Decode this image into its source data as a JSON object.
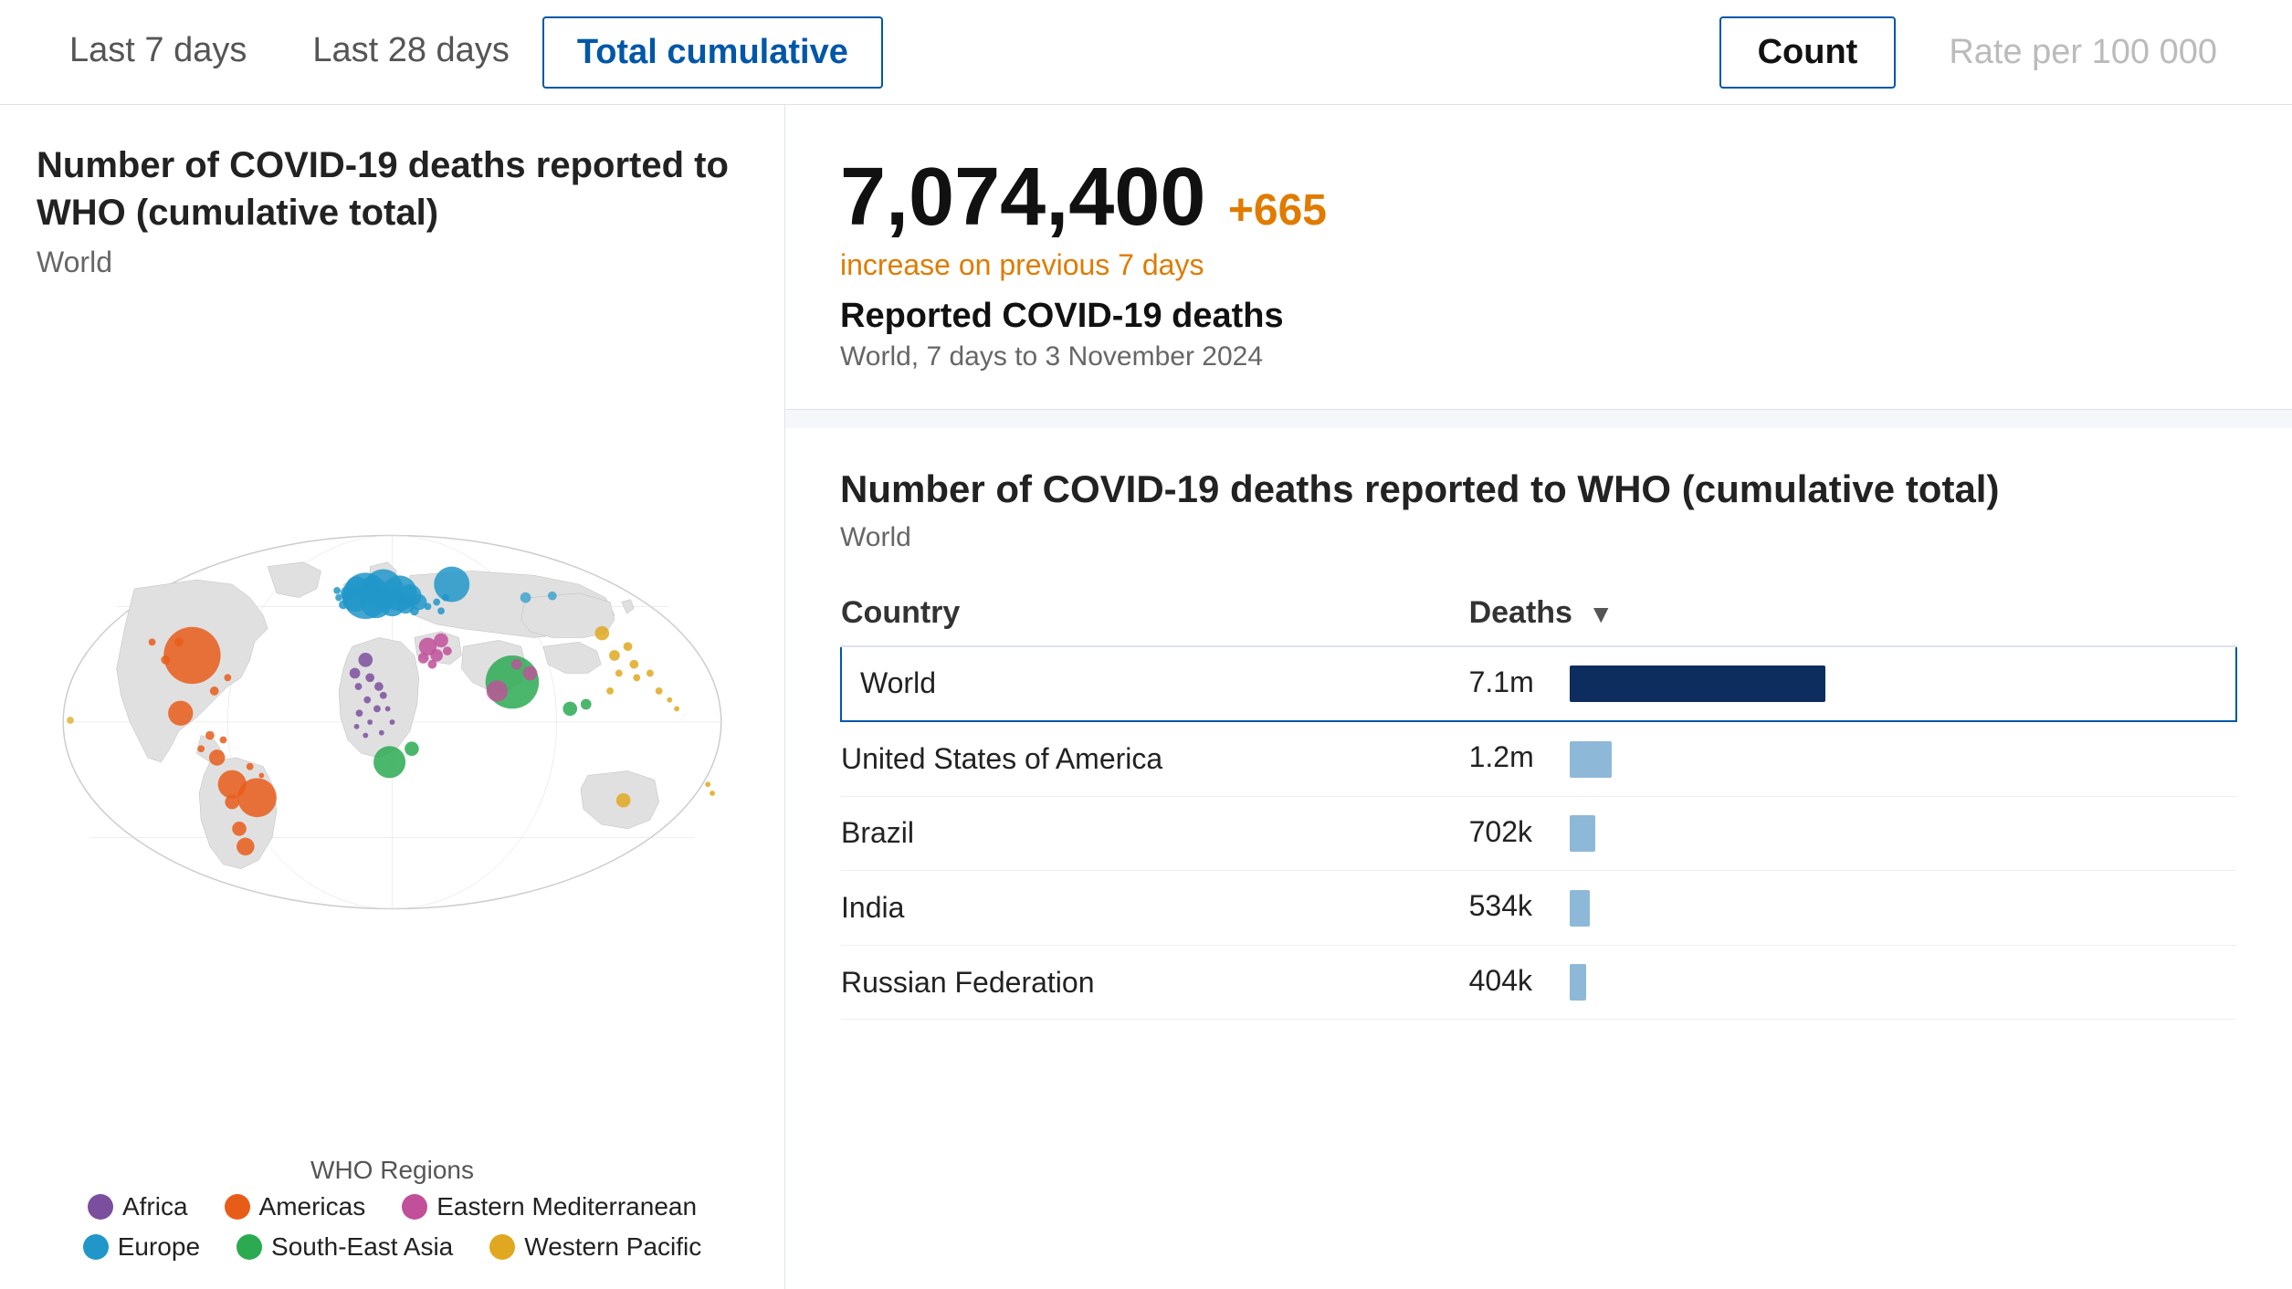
{
  "tabs": {
    "last7": "Last 7 days",
    "last28": "Last 28 days",
    "totalCumulative": "Total cumulative"
  },
  "metrics": {
    "count": "Count",
    "ratePer100k": "Rate per 100 000"
  },
  "chart": {
    "title": "Number of COVID-19 deaths reported to WHO (cumulative total)",
    "subtitle": "World"
  },
  "legend": {
    "title": "WHO Regions",
    "items": [
      {
        "label": "Africa",
        "color": "#7b4f9e"
      },
      {
        "label": "Americas",
        "color": "#e85c1a"
      },
      {
        "label": "Eastern Mediterranean",
        "color": "#c14f9a"
      },
      {
        "label": "Europe",
        "color": "#2196c9"
      },
      {
        "label": "South-East Asia",
        "color": "#2caa52"
      },
      {
        "label": "Western Pacific",
        "color": "#e0a820"
      }
    ]
  },
  "statsCard": {
    "number": "7,074,400",
    "change": "+665",
    "changeLabel": "increase on previous 7 days",
    "label": "Reported COVID-19 deaths",
    "meta": "World, 7 days to 3 November 2024"
  },
  "tableCard": {
    "title": "Number of COVID-19 deaths reported to WHO (cumulative total)",
    "subtitle": "World",
    "headers": {
      "country": "Country",
      "deaths": "Deaths"
    },
    "rows": [
      {
        "country": "World",
        "deaths": "7.1m",
        "barClass": "bar-world",
        "isWorld": true
      },
      {
        "country": "United States of America",
        "deaths": "1.2m",
        "barClass": "bar-usa",
        "isWorld": false
      },
      {
        "country": "Brazil",
        "deaths": "702k",
        "barClass": "bar-brazil",
        "isWorld": false
      },
      {
        "country": "India",
        "deaths": "534k",
        "barClass": "bar-india",
        "isWorld": false
      },
      {
        "country": "Russian Federation",
        "deaths": "404k",
        "barClass": "bar-russia",
        "isWorld": false
      }
    ]
  }
}
